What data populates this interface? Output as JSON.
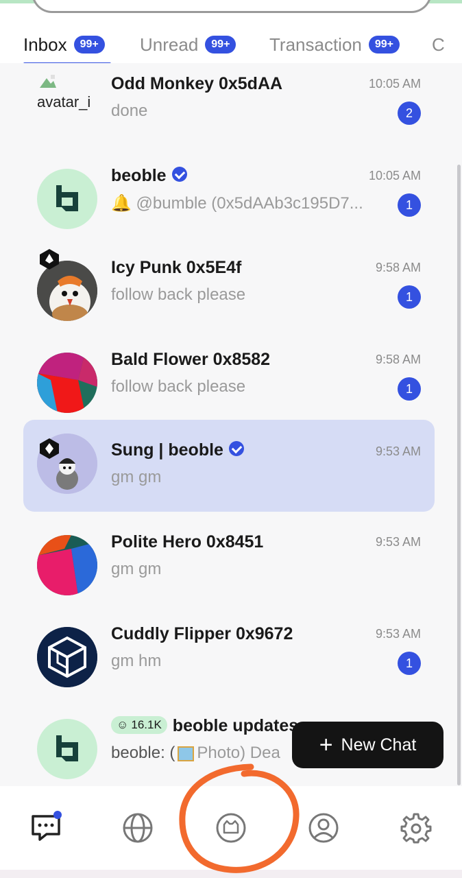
{
  "tabs": [
    {
      "label": "Inbox",
      "count": "99+",
      "active": true
    },
    {
      "label": "Unread",
      "count": "99+"
    },
    {
      "label": "Transaction",
      "count": "99+"
    },
    {
      "label": "C"
    }
  ],
  "chats": [
    {
      "name": "Odd Monkey 0x5dAA",
      "preview": "done",
      "time": "10:05 AM",
      "unread": "2",
      "avatar_alt": "avatar_i"
    },
    {
      "name": "beoble",
      "preview": "🔔 @bumble (0x5dAAb3c195D7...",
      "time": "10:05 AM",
      "unread": "1",
      "verified": true
    },
    {
      "name": "Icy Punk 0x5E4f",
      "preview": "follow back please",
      "time": "9:58 AM",
      "unread": "1"
    },
    {
      "name": "Bald Flower 0x8582",
      "preview": "follow back please",
      "time": "9:58 AM",
      "unread": "1"
    },
    {
      "name": "Sung | beoble",
      "preview": "gm gm",
      "time": "9:53 AM",
      "verified": true,
      "selected": true
    },
    {
      "name": "Polite Hero 0x8451",
      "preview": "gm gm",
      "time": "9:53 AM"
    },
    {
      "name": "Cuddly Flipper 0x9672",
      "preview": "gm hm",
      "time": "9:53 AM",
      "unread": "1"
    },
    {
      "name": "beoble updates",
      "followers": "16.1K",
      "preview_prefix": "beoble: (",
      "preview_photo": "Photo",
      "preview_suffix": ") Dea"
    }
  ],
  "new_chat": {
    "label": "New Chat"
  },
  "bottom_nav": [
    "chat-icon",
    "globe-icon",
    "cat-face-icon",
    "profile-icon",
    "gear-icon"
  ],
  "colors": {
    "accent": "#3451e0",
    "selected_row": "#d6dcf5",
    "annotation": "#f26a2e",
    "beoble_green": "#c9efd3"
  }
}
